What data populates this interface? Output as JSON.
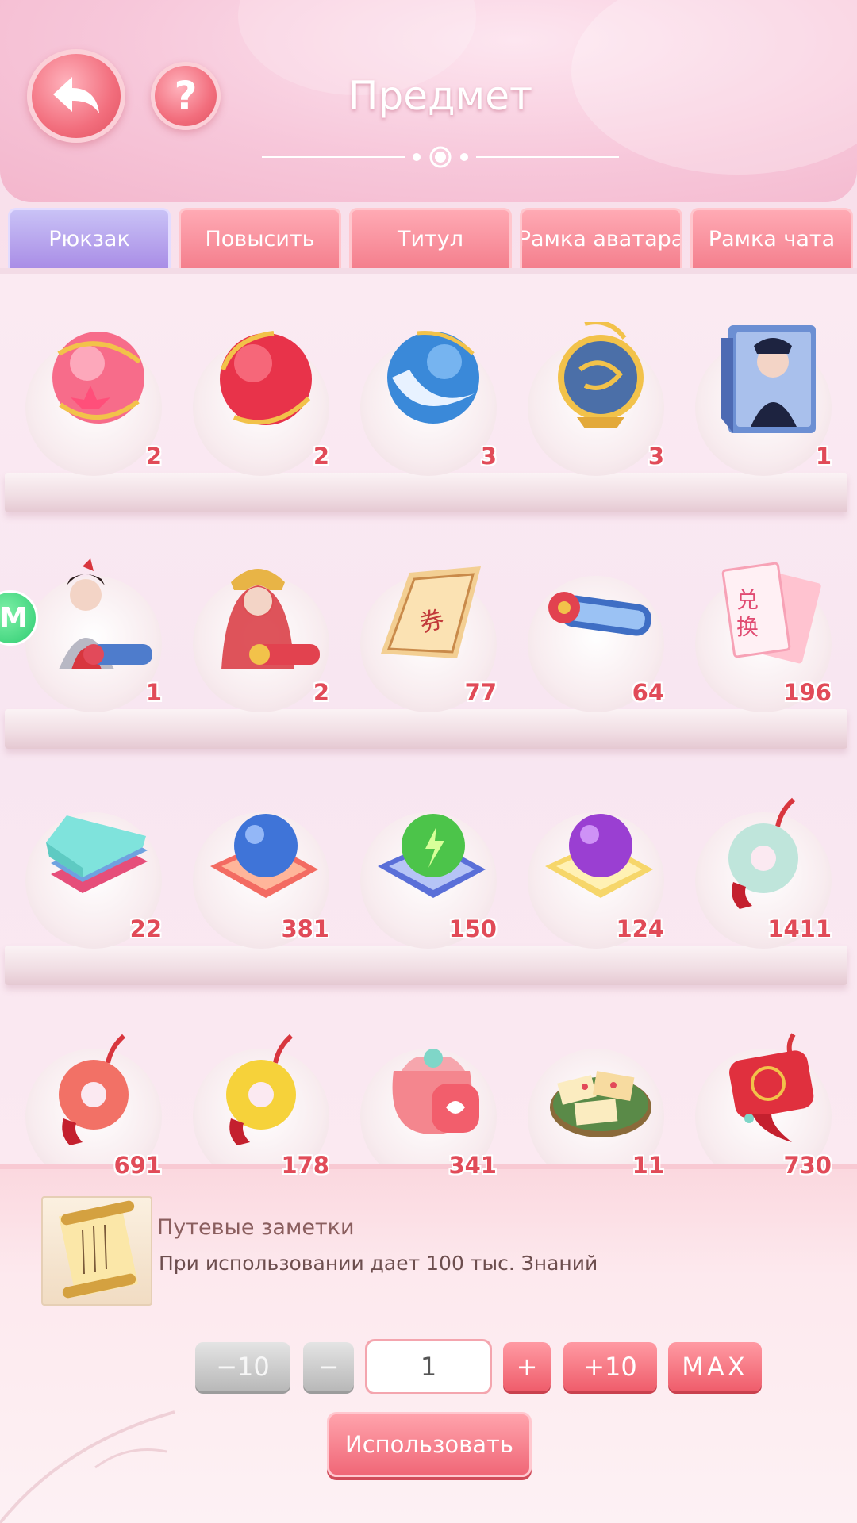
{
  "header": {
    "title": "Предмет",
    "back_icon": "back-arrow-icon",
    "help_label": "?"
  },
  "tabs": [
    {
      "label": "Рюкзак",
      "active": true
    },
    {
      "label": "Повысить",
      "active": false
    },
    {
      "label": "Титул",
      "active": false
    },
    {
      "label": "Рамка аватара",
      "active": false
    },
    {
      "label": "Рамка чата",
      "active": false
    }
  ],
  "side_badge": {
    "label": "M"
  },
  "inventory": {
    "rows": [
      [
        {
          "icon": "pink-lotus-orb-icon",
          "count": "2"
        },
        {
          "icon": "red-orb-icon",
          "count": "2"
        },
        {
          "icon": "blue-orb-icon",
          "count": "3"
        },
        {
          "icon": "golden-dragon-orb-icon",
          "count": "3"
        },
        {
          "icon": "portrait-book-icon",
          "count": "1"
        }
      ],
      [
        {
          "icon": "warrior-lady-scroll-icon",
          "count": "1"
        },
        {
          "icon": "bride-scroll-icon",
          "count": "2"
        },
        {
          "icon": "paper-ticket-icon",
          "count": "77"
        },
        {
          "icon": "blue-scroll-icon",
          "count": "64"
        },
        {
          "icon": "exchange-tickets-icon",
          "count": "196"
        }
      ],
      [
        {
          "icon": "cloth-stack-icon",
          "count": "22"
        },
        {
          "icon": "blue-pearl-cushion-icon",
          "count": "381"
        },
        {
          "icon": "green-pearl-cushion-icon",
          "count": "150"
        },
        {
          "icon": "purple-pearl-cushion-icon",
          "count": "124"
        },
        {
          "icon": "jade-pendant-icon",
          "count": "1411"
        }
      ],
      [
        {
          "icon": "red-jade-pendant-icon",
          "count": "691"
        },
        {
          "icon": "yellow-jade-pendant-icon",
          "count": "178"
        },
        {
          "icon": "gift-pouch-icon",
          "count": "341"
        },
        {
          "icon": "pastry-plate-icon",
          "count": "11"
        },
        {
          "icon": "red-lantern-charm-icon",
          "count": "730"
        }
      ]
    ]
  },
  "detail": {
    "icon": "travel-notes-scroll-icon",
    "name": "Путевые заметки",
    "description": "При использовании дает 100 тыс. Знаний"
  },
  "controls": {
    "minus10": "−10",
    "minus": "−",
    "quantity": "1",
    "plus": "+",
    "plus10": "+10",
    "max": "MAX",
    "use": "Использовать"
  },
  "colors": {
    "accent_red": "#ef5d6b",
    "active_tab": "#a98de6",
    "count_text": "#e14b58"
  }
}
